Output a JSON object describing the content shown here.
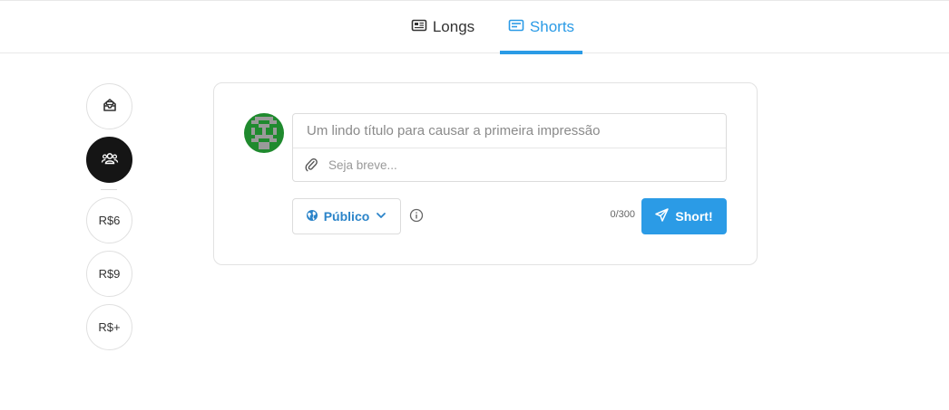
{
  "tabs": [
    {
      "label": "Longs",
      "icon": "newspaper-icon",
      "active": false
    },
    {
      "label": "Shorts",
      "icon": "card-icon",
      "active": true
    }
  ],
  "sidebar": {
    "items": [
      {
        "type": "icon",
        "icon": "inbox-icon",
        "active": false
      },
      {
        "type": "icon",
        "icon": "group-icon",
        "active": true
      },
      {
        "type": "text",
        "label": "R$6",
        "active": false
      },
      {
        "type": "text",
        "label": "R$9",
        "active": false
      },
      {
        "type": "text",
        "label": "R$+",
        "active": false
      }
    ]
  },
  "composer": {
    "title_placeholder": "Um lindo título para causar a primeira impressão",
    "title_value": "",
    "description_placeholder": "Seja breve...",
    "description_value": "",
    "visibility_label": "Público",
    "char_count": "0/300",
    "submit_label": "Short!"
  },
  "colors": {
    "accent": "#2b9be6",
    "visibility_text": "#2b84c9",
    "active_sidebar_bg": "#151515",
    "avatar_green": "#1f8a2e",
    "avatar_gray": "#9a9a9a"
  }
}
